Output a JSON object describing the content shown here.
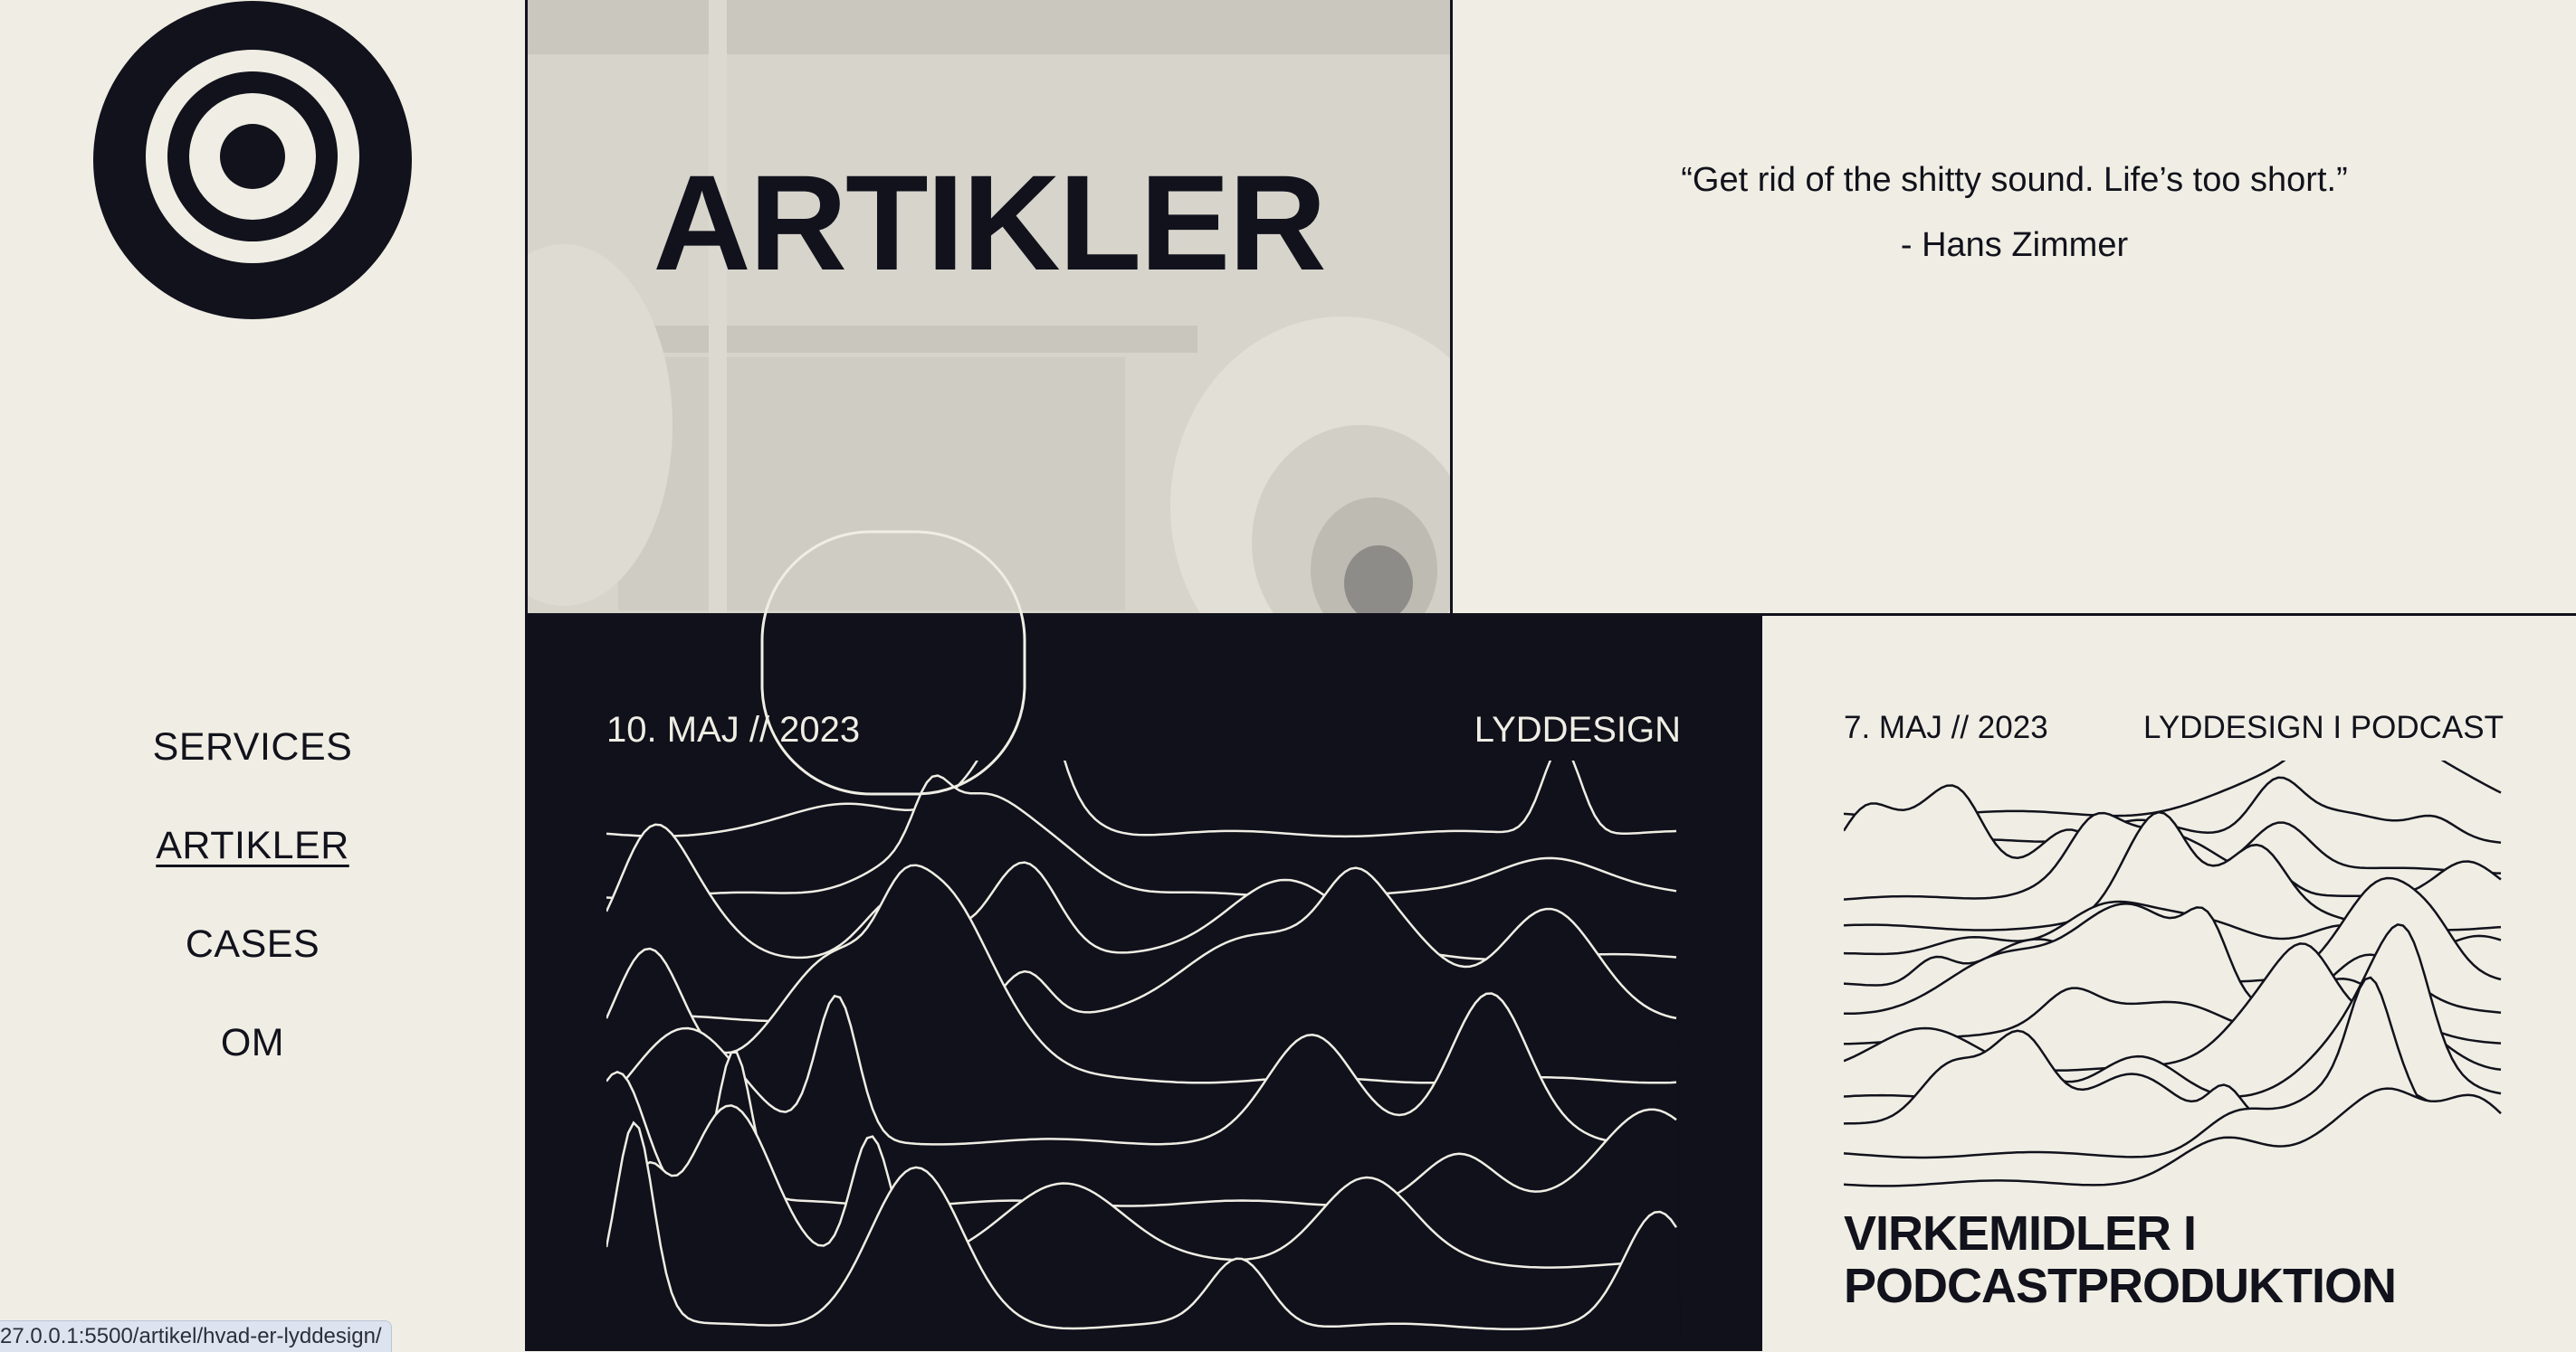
{
  "nav": {
    "items": [
      {
        "label": "SERVICES",
        "active": false
      },
      {
        "label": "ARTIKLER",
        "active": true
      },
      {
        "label": "CASES",
        "active": false
      },
      {
        "label": "OM",
        "active": false
      }
    ]
  },
  "hero": {
    "title": "ARTIKLER"
  },
  "quote": {
    "text": "“Get rid of the shitty sound. Life’s too short.”",
    "author": "- Hans Zimmer"
  },
  "articles": [
    {
      "date": "10. MAJ // 2023",
      "category": "LYDDESIGN"
    },
    {
      "date": "7. MAJ // 2023",
      "category": "LYDDESIGN I PODCAST",
      "title": "VIRKEMIDLER I PODCASTPRODUKTION"
    }
  ],
  "status_bar": {
    "url": "27.0.0.1:5500/artikel/hvad-er-lyddesign/"
  },
  "colors": {
    "background": "#f0eee4",
    "ink": "#11121c",
    "dark_card": "#10111b"
  }
}
